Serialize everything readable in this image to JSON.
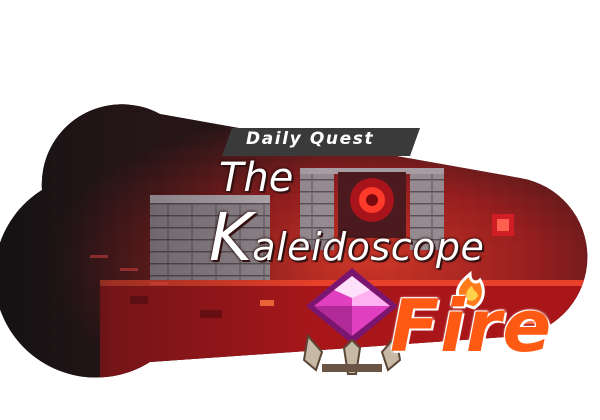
{
  "banner": {
    "tag_label": "Daily Quest",
    "title_line1": "The",
    "title_line2_initial": "K",
    "title_line2_rest": "aleidoscope",
    "title_line3": "Fire"
  },
  "colors": {
    "background": "#ffffff",
    "tag_background": "#3a3a3a",
    "title_text": "#ffffff",
    "fire_text": "#ff5a14",
    "flame": "#ff7a1a",
    "gem_magenta": "#e040c0",
    "gem_pink": "#ffb0f0",
    "lava_red": "#c0181c",
    "dungeon_stone": "#8a7f86"
  },
  "icons": {
    "flame": "flame-icon",
    "gem": "kaleidoscope-gem-icon"
  }
}
